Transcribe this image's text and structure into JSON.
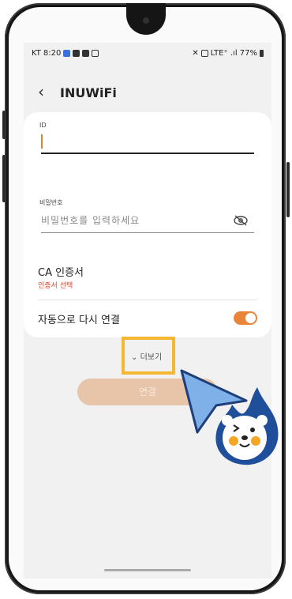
{
  "status_bar": {
    "carrier": "KT",
    "time": "8:20",
    "right_text": "LTE⁺ .ıl 77%"
  },
  "header": {
    "back_icon": "chevron-left-icon",
    "title": "INUWiFi"
  },
  "form": {
    "id_label": "ID",
    "password_label": "비밀번호",
    "password_placeholder": "비밀번호를 입력하세요",
    "ca_title": "CA 인증서",
    "ca_subtitle": "인증서 선택",
    "auto_reconnect_label": "자동으로 다시 연결",
    "auto_reconnect_on": true
  },
  "more_label": "더보기",
  "connect_label": "연결",
  "colors": {
    "accent": "#e8853a",
    "highlight": "#f5b731",
    "warning_text": "#e0402a",
    "pointer": "#7fb0e8",
    "mascot": "#1f4e9a"
  }
}
